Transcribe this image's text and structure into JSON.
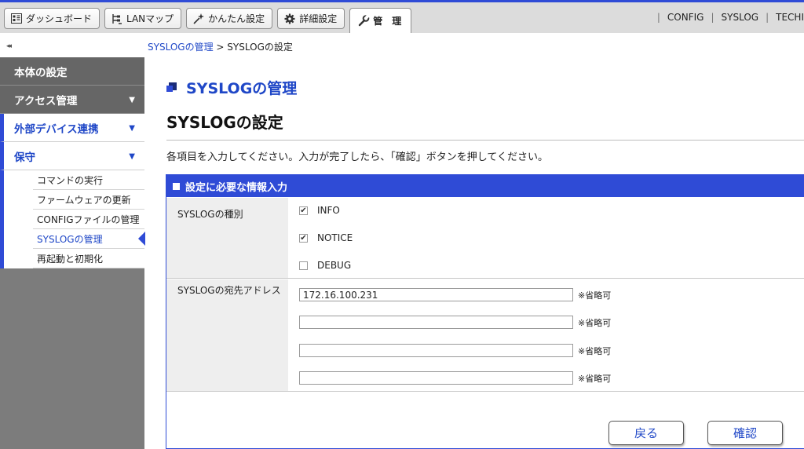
{
  "tabs": [
    {
      "label": "ダッシュボード",
      "icon": "dashboard-icon"
    },
    {
      "label": "LANマップ",
      "icon": "lan-map-icon"
    },
    {
      "label": "かんたん設定",
      "icon": "wizard-icon"
    },
    {
      "label": "詳細設定",
      "icon": "gear-icon"
    },
    {
      "label": "管　理",
      "icon": "wrench-icon"
    }
  ],
  "toplinks": [
    "CONFIG",
    "SYSLOG",
    "TECHI"
  ],
  "collapse_glyph": "◂◂",
  "breadcrumb": {
    "parent": "SYSLOGの管理",
    "separator": ">",
    "current": "SYSLOGの設定"
  },
  "sidebar": {
    "items": [
      {
        "label": "本体の設定"
      },
      {
        "label": "アクセス管理",
        "arrow": "▼"
      },
      {
        "label": "外部デバイス連携",
        "arrow": "▼"
      },
      {
        "label": "保守",
        "arrow": "▼"
      }
    ],
    "submenu": [
      "コマンドの実行",
      "ファームウェアの更新",
      "CONFIGファイルの管理",
      "SYSLOGの管理",
      "再起動と初期化"
    ]
  },
  "main": {
    "section_title": "SYSLOGの管理",
    "page_title": "SYSLOGの設定",
    "instruction": "各項目を入力してください。入力が完了したら、「確認」ボタンを押してください。",
    "panel_title": "設定に必要な情報入力",
    "type_label": "SYSLOGの種別",
    "checkboxes": [
      {
        "label": "INFO",
        "checked": true
      },
      {
        "label": "NOTICE",
        "checked": true
      },
      {
        "label": "DEBUG",
        "checked": false
      }
    ],
    "address_label": "SYSLOGの宛先アドレス",
    "addresses": [
      "172.16.100.231",
      "",
      "",
      ""
    ],
    "optional_note": "※省略可",
    "back_button": "戻る",
    "confirm_button": "確認"
  },
  "colors": {
    "accent": "#2f4bd6",
    "link": "#1f47c7",
    "sidebar": "#666666"
  }
}
